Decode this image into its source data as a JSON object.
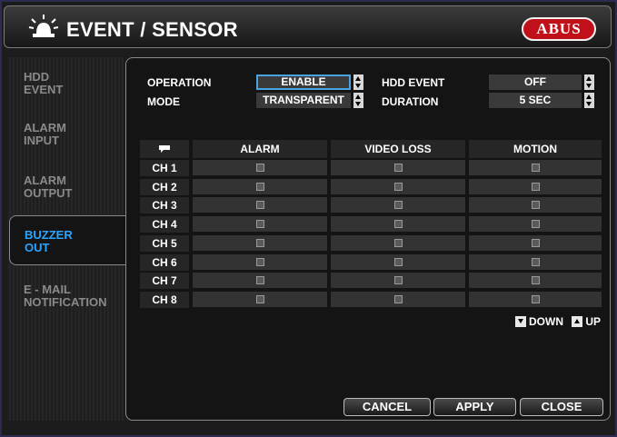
{
  "window": {
    "title": "EVENT / SENSOR",
    "brand": "ABUS"
  },
  "tabs": [
    {
      "label_1": "HDD",
      "label_2": "EVENT"
    },
    {
      "label_1": "ALARM",
      "label_2": "INPUT"
    },
    {
      "label_1": "ALARM",
      "label_2": "OUTPUT"
    },
    {
      "label_1": "BUZZER",
      "label_2": "OUT"
    },
    {
      "label_1": "E - MAIL",
      "label_2": "NOTIFICATION"
    }
  ],
  "active_tab": "BUZZER OUT",
  "settings": {
    "operation_label": "OPERATION",
    "operation_value": "ENABLE",
    "mode_label": "MODE",
    "mode_value": "TRANSPARENT",
    "hdd_event_label": "HDD EVENT",
    "hdd_event_value": "OFF",
    "duration_label": "DURATION",
    "duration_value": "5 SEC"
  },
  "table": {
    "columns": [
      "ALARM",
      "VIDEO LOSS",
      "MOTION"
    ],
    "rows": [
      "CH 1",
      "CH 2",
      "CH 3",
      "CH 4",
      "CH 5",
      "CH 6",
      "CH 7",
      "CH 8"
    ]
  },
  "nav": {
    "down": "DOWN",
    "up": "UP"
  },
  "buttons": {
    "cancel": "CANCEL",
    "apply": "APPLY",
    "close": "CLOSE"
  },
  "colors": {
    "accent": "#2aa5ff",
    "brand": "#c0101a"
  }
}
